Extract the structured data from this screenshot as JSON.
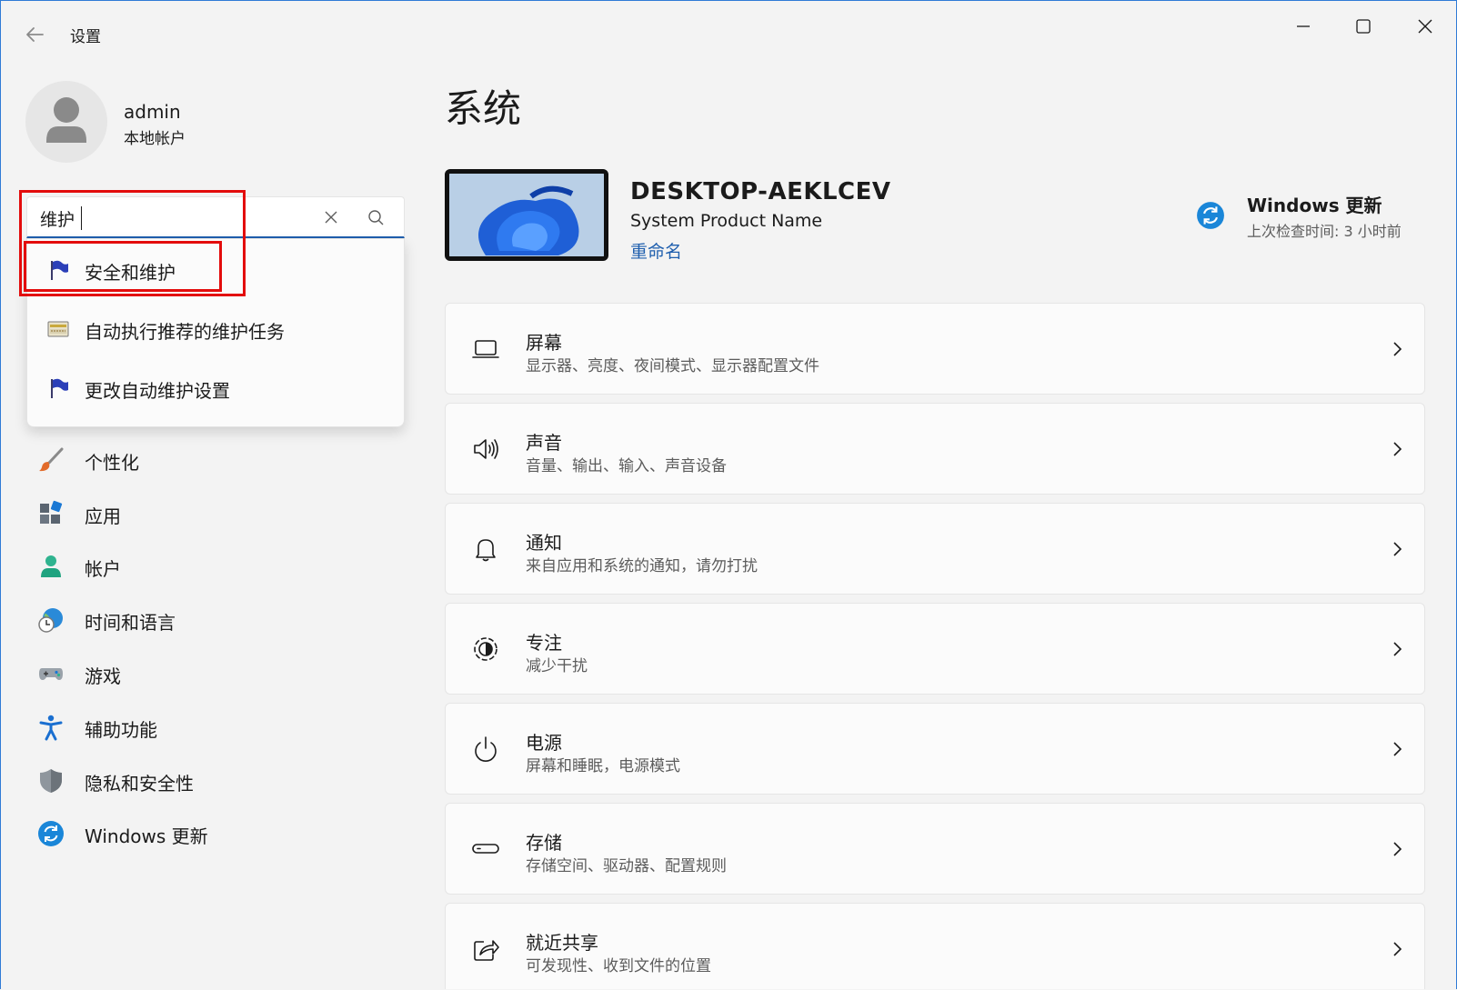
{
  "window": {
    "title": "设置",
    "controls": [
      "minimize",
      "maximize",
      "close"
    ]
  },
  "profile": {
    "name": "admin",
    "account_type": "本地帐户"
  },
  "search": {
    "value": "维护",
    "results": [
      {
        "label": "安全和维护",
        "icon": "flag-icon",
        "highlighted": true
      },
      {
        "label": "自动执行推荐的维护任务",
        "icon": "control-panel-icon",
        "highlighted": false
      },
      {
        "label": "更改自动维护设置",
        "icon": "flag-icon",
        "highlighted": false
      }
    ]
  },
  "sidebar": {
    "items": [
      {
        "label": "个性化",
        "icon": "brush-icon"
      },
      {
        "label": "应用",
        "icon": "apps-icon"
      },
      {
        "label": "帐户",
        "icon": "person-icon"
      },
      {
        "label": "时间和语言",
        "icon": "globe-clock-icon"
      },
      {
        "label": "游戏",
        "icon": "gamepad-icon"
      },
      {
        "label": "辅助功能",
        "icon": "accessibility-icon"
      },
      {
        "label": "隐私和安全性",
        "icon": "shield-icon"
      },
      {
        "label": "Windows 更新",
        "icon": "windows-update-icon"
      }
    ]
  },
  "main": {
    "title": "系统",
    "device": {
      "name": "DESKTOP-AEKLCEV",
      "model": "System Product Name",
      "rename": "重命名"
    },
    "update": {
      "title": "Windows 更新",
      "subtitle": "上次检查时间: 3 小时前"
    },
    "cards": [
      {
        "title": "屏幕",
        "subtitle": "显示器、亮度、夜间模式、显示器配置文件",
        "icon": "laptop-icon"
      },
      {
        "title": "声音",
        "subtitle": "音量、输出、输入、声音设备",
        "icon": "speaker-icon"
      },
      {
        "title": "通知",
        "subtitle": "来自应用和系统的通知，请勿打扰",
        "icon": "bell-icon"
      },
      {
        "title": "专注",
        "subtitle": "减少干扰",
        "icon": "focus-icon"
      },
      {
        "title": "电源",
        "subtitle": "屏幕和睡眠，电源模式",
        "icon": "power-icon"
      },
      {
        "title": "存储",
        "subtitle": "存储空间、驱动器、配置规则",
        "icon": "storage-icon"
      },
      {
        "title": "就近共享",
        "subtitle": "可发现性、收到文件的位置",
        "icon": "share-icon"
      }
    ]
  },
  "colors": {
    "accent": "#1f5fae",
    "highlight_box": "#e30c0c",
    "background": "#f3f3f3",
    "card": "#fbfbfb"
  }
}
